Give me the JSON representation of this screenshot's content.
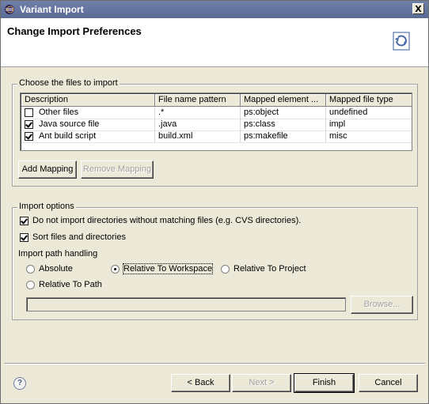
{
  "window": {
    "title": "Variant Import",
    "close_label": "X"
  },
  "banner": {
    "title": "Change Import Preferences",
    "icon": "import-wizard-icon"
  },
  "files_group": {
    "label": "Choose the files to import",
    "columns": [
      "Description",
      "File name pattern",
      "Mapped element ...",
      "Mapped file type"
    ],
    "rows": [
      {
        "checked": false,
        "description": "Other files",
        "pattern": ".*",
        "element": "ps:object",
        "type": "undefined"
      },
      {
        "checked": true,
        "description": "Java source file",
        "pattern": ".java",
        "element": "ps:class",
        "type": "impl"
      },
      {
        "checked": true,
        "description": "Ant build script",
        "pattern": "build.xml",
        "element": "ps:makefile",
        "type": "misc"
      }
    ],
    "add_mapping": "Add Mapping",
    "remove_mapping": "Remove Mapping"
  },
  "import_options": {
    "label": "Import options",
    "opt_no_empty_dirs": {
      "label": "Do not import directories without matching files (e.g. CVS directories).",
      "checked": true
    },
    "opt_sort": {
      "label": "Sort files and directories",
      "checked": true
    },
    "path_handling_label": "Import path handling",
    "radios": {
      "absolute": {
        "label": "Absolute",
        "selected": false
      },
      "workspace": {
        "label": "Relative To Workspace",
        "selected": true
      },
      "project": {
        "label": "Relative To Project",
        "selected": false
      },
      "path": {
        "label": "Relative To Path",
        "selected": false
      }
    },
    "path_value": "",
    "browse": "Browse..."
  },
  "footer": {
    "help_icon": "help-icon",
    "help_glyph": "?",
    "back": "< Back",
    "next": "Next >",
    "finish": "Finish",
    "cancel": "Cancel"
  }
}
